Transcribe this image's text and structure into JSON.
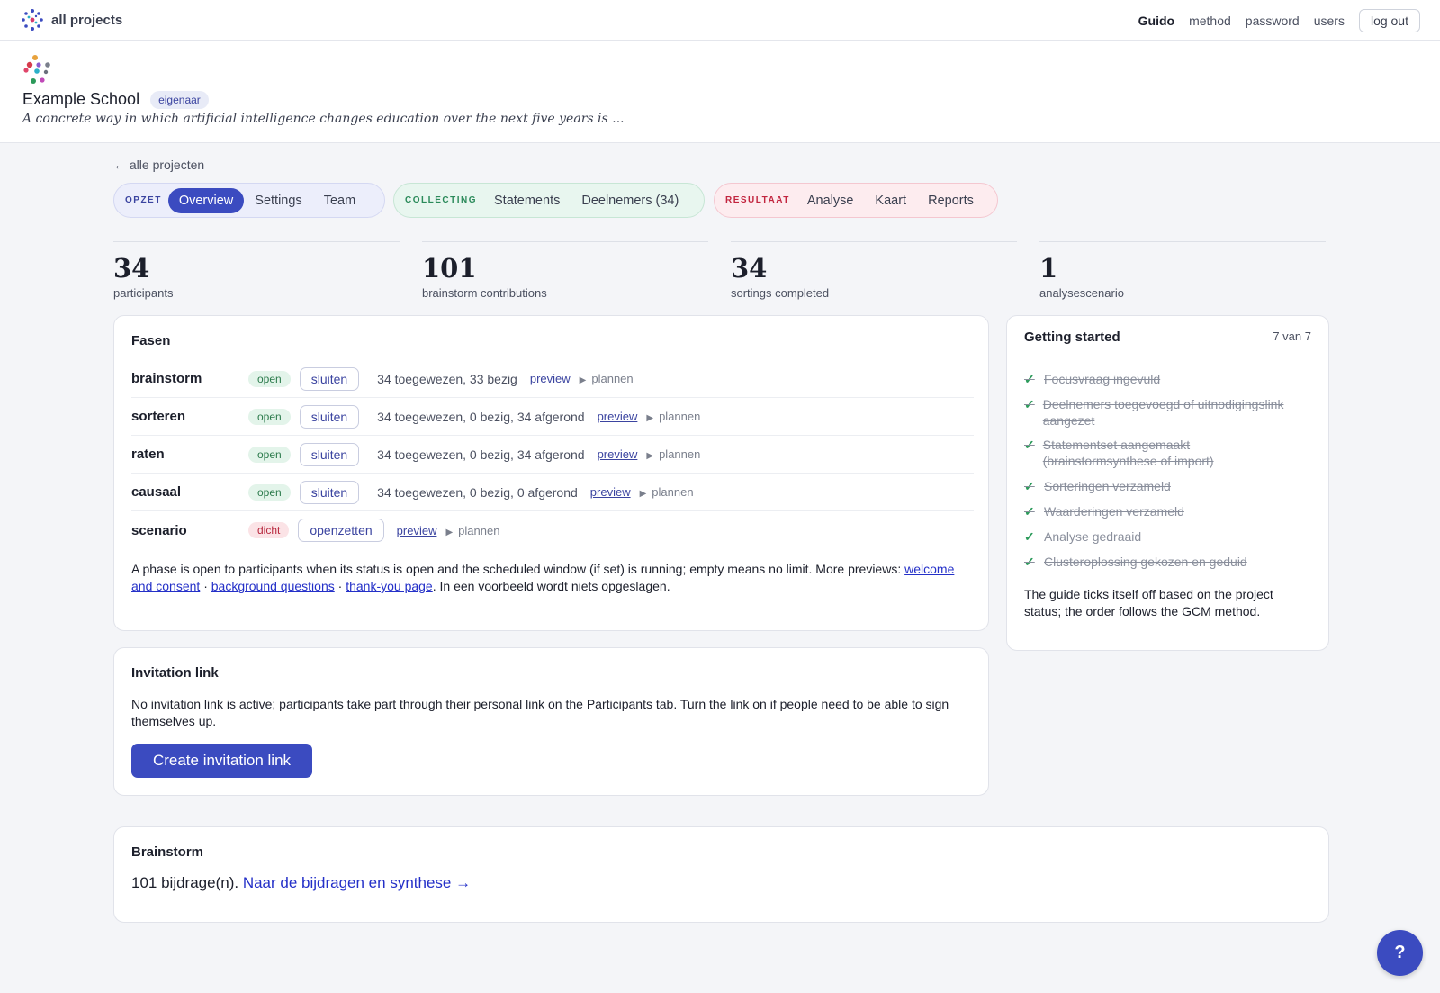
{
  "topbar": {
    "brand": "all projects",
    "user": "Guido",
    "nav": [
      "method",
      "password",
      "users"
    ],
    "logout": "log out"
  },
  "project": {
    "name": "Example School",
    "role": "eigenaar",
    "focus": "A concrete way in which artificial intelligence changes education over the next five years is ..."
  },
  "back_link": "← alle projecten",
  "tabgroups": {
    "opzet": {
      "tag": "OPZET",
      "tabs": [
        "Overview",
        "Settings",
        "Team"
      ]
    },
    "collecting": {
      "tag": "COLLECTING",
      "tabs": [
        "Statements",
        "Deelnemers (34)"
      ]
    },
    "resultaat": {
      "tag": "RESULTAAT",
      "tabs": [
        "Analyse",
        "Kaart",
        "Reports"
      ]
    }
  },
  "stats": [
    {
      "value": "34",
      "label": "participants"
    },
    {
      "value": "101",
      "label": "brainstorm contributions"
    },
    {
      "value": "34",
      "label": "sortings completed"
    },
    {
      "value": "1",
      "label": "analysescenario"
    }
  ],
  "phases": {
    "title": "Fasen",
    "rows": [
      {
        "name": "brainstorm",
        "status": "open",
        "action": "sluiten",
        "counts": "34 toegewezen, 33 bezig",
        "preview": "preview",
        "plan": "plannen"
      },
      {
        "name": "sorteren",
        "status": "open",
        "action": "sluiten",
        "counts": "34 toegewezen, 0 bezig, 34 afgerond",
        "preview": "preview",
        "plan": "plannen"
      },
      {
        "name": "raten",
        "status": "open",
        "action": "sluiten",
        "counts": "34 toegewezen, 0 bezig, 34 afgerond",
        "preview": "preview",
        "plan": "plannen"
      },
      {
        "name": "causaal",
        "status": "open",
        "action": "sluiten",
        "counts": "34 toegewezen, 0 bezig, 0 afgerond",
        "preview": "preview",
        "plan": "plannen"
      },
      {
        "name": "scenario",
        "status": "dicht",
        "action": "openzetten",
        "counts": "",
        "preview": "preview",
        "plan": "plannen"
      }
    ],
    "note_text": "A phase is open to participants when its status is open and the scheduled window (if set) is running; empty means no limit. More previews:",
    "note_links": [
      "welcome and consent",
      "background questions",
      "thank-you page"
    ],
    "note_sep": "·",
    "note_tail": ". In een voorbeeld wordt niets opgeslagen."
  },
  "invitation": {
    "title": "Invitation link",
    "text": "No invitation link is active; participants take part through their personal link on the Participants tab. Turn the link on if people need to be able to sign themselves up.",
    "button": "Create invitation link"
  },
  "getting_started": {
    "title": "Getting started",
    "count": "7 van 7",
    "items": [
      "Focusvraag ingevuld",
      "Deelnemers toegevoegd of uitnodigingslink aangezet",
      "Statementset aangemaakt (brainstormsynthese of import)",
      "Sorteringen verzameld",
      "Waarderingen verzameld",
      "Analyse gedraaid",
      "Clusteroplossing gekozen en geduid"
    ],
    "note": "The guide ticks itself off based on the project status; the order follows the GCM method."
  },
  "brainstorm": {
    "title": "Brainstorm",
    "text": "101 bijdrage(n).",
    "link": "Naar de bijdragen en synthese →"
  },
  "help": "?"
}
